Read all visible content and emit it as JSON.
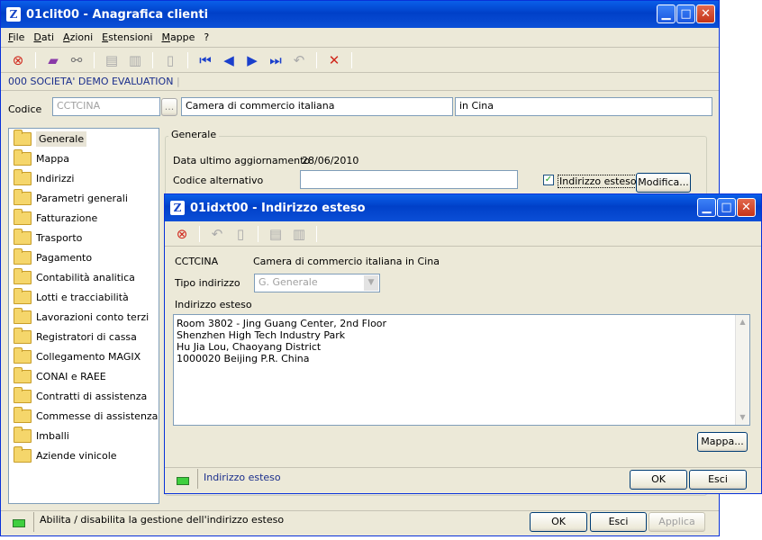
{
  "main": {
    "title": "01clit00 - Anagrafica clienti",
    "menu": [
      "File",
      "Dati",
      "Azioni",
      "Estensioni",
      "Mappe",
      "?"
    ],
    "company": "000 SOCIETA' DEMO EVALUATION",
    "codice_label": "Codice",
    "codice_value": "CCTCINA",
    "browse_label": "...",
    "name_value": "Camera di commercio italiana",
    "name2_value": "in Cina",
    "tree": [
      "Generale",
      "Mappa",
      "Indirizzi",
      "Parametri generali",
      "Fatturazione",
      "Trasporto",
      "Pagamento",
      "Contabilità analitica",
      "Lotti e tracciabilità",
      "Lavorazioni conto terzi",
      "Registratori di cassa",
      "Collegamento MAGIX",
      "CONAI e RAEE",
      "Contratti di assistenza",
      "Commesse di assistenza",
      "Imballi",
      "Aziende vinicole"
    ],
    "group_label": "Generale",
    "last_update_label": "Data ultimo aggiornamento",
    "last_update_value": "28/06/2010",
    "alt_code_label": "Codice alternativo",
    "alt_code_value": "",
    "ext_addr_label": "Indirizzo esteso",
    "ext_addr_checked": true,
    "modifica_label": "Modifica...",
    "status_text": "Abilita / disabilita la gestione dell'indirizzo esteso",
    "ok_label": "OK",
    "esci_label": "Esci",
    "applica_label": "Applica"
  },
  "dialog": {
    "title": "01idxt00 - Indirizzo esteso",
    "code": "CCTCINA",
    "name": "Camera di commercio italiana in Cina",
    "tipo_label": "Tipo indirizzo",
    "tipo_value": "G. Generale",
    "addr_label": "Indirizzo esteso",
    "address_lines": [
      "Room 3802 - Jing Guang Center, 2nd Floor",
      "Shenzhen High Tech Industry Park",
      "Hu Jia Lou, Chaoyang District",
      "1000020 Beijing P.R. China"
    ],
    "mappa_label": "Mappa...",
    "status_text": "Indirizzo esteso",
    "ok_label": "OK",
    "esci_label": "Esci"
  },
  "colors": {
    "title_blue": "#0a5fe9",
    "close_red": "#c53418",
    "status_green": "#3fcf3f"
  }
}
